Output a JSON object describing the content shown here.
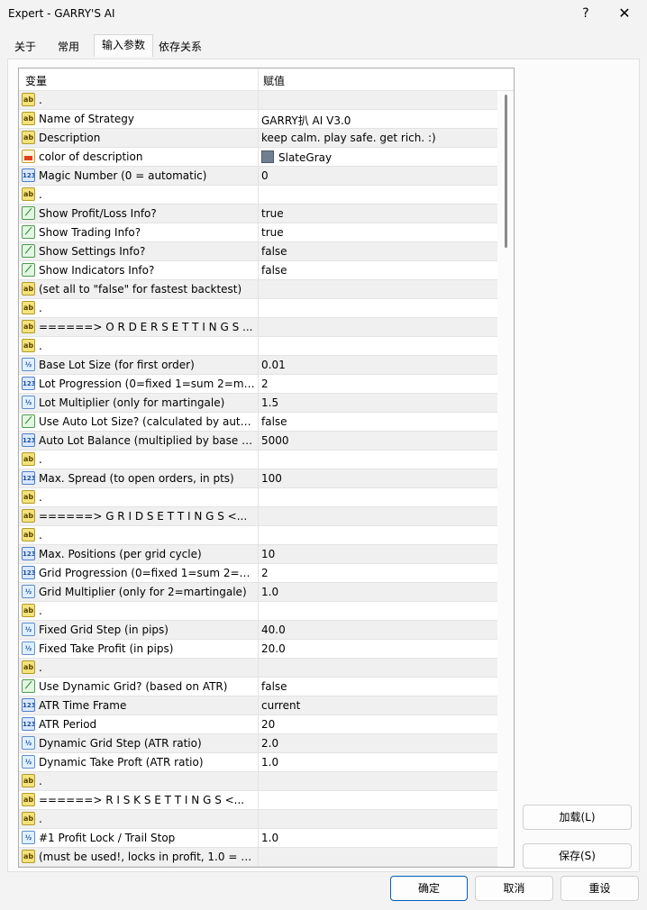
{
  "window": {
    "title": "Expert - GARRY'S AI",
    "help": "?",
    "close": "✕"
  },
  "tabs": [
    "关于",
    "常用",
    "输入参数",
    "依存关系"
  ],
  "columns": {
    "variable": "变量",
    "value": "赋值"
  },
  "rows": [
    {
      "type": "ab",
      "name": ".",
      "value": ""
    },
    {
      "type": "ab",
      "name": "Name of Strategy",
      "value": "GARRY扒 AI V3.0"
    },
    {
      "type": "ab",
      "name": "Description",
      "value": "keep calm. play safe. get rich. :)"
    },
    {
      "type": "clr",
      "name": "color of description",
      "value": "SlateGray",
      "color": "#708090"
    },
    {
      "type": "n123",
      "name": "Magic Number (0 = automatic)",
      "value": "0"
    },
    {
      "type": "ab",
      "name": ".",
      "value": ""
    },
    {
      "type": "bool",
      "name": "Show Profit/Loss Info?",
      "value": "true"
    },
    {
      "type": "bool",
      "name": "Show Trading Info?",
      "value": "true"
    },
    {
      "type": "bool",
      "name": "Show Settings Info?",
      "value": "false"
    },
    {
      "type": "bool",
      "name": "Show Indicators Info?",
      "value": "false"
    },
    {
      "type": "ab",
      "name": "(set all to \"false\" for fastest backtest)",
      "value": ""
    },
    {
      "type": "ab",
      "name": ".",
      "value": ""
    },
    {
      "type": "ab",
      "name": "======>  O R D E R   S E T T I N G S ...",
      "value": ""
    },
    {
      "type": "ab",
      "name": ".",
      "value": ""
    },
    {
      "type": "ve",
      "name": "Base Lot Size (for first order)",
      "value": "0.01"
    },
    {
      "type": "n123",
      "name": "Lot Progression (0=fixed 1=sum 2=mar...",
      "value": "2"
    },
    {
      "type": "ve",
      "name": "Lot Multiplier (only for martingale)",
      "value": "1.5"
    },
    {
      "type": "bool",
      "name": "Use Auto Lot Size? (calculated by auto l...",
      "value": "false"
    },
    {
      "type": "n123",
      "name": "Auto Lot Balance (multiplied by base lo...",
      "value": "5000"
    },
    {
      "type": "ab",
      "name": ".",
      "value": ""
    },
    {
      "type": "n123",
      "name": "Max. Spread (to open orders, in pts)",
      "value": "100"
    },
    {
      "type": "ab",
      "name": ".",
      "value": ""
    },
    {
      "type": "ab",
      "name": "======>  G R I D   S E T T I N G S  <...",
      "value": ""
    },
    {
      "type": "ab",
      "name": ".",
      "value": ""
    },
    {
      "type": "n123",
      "name": "Max. Positions (per grid cycle)",
      "value": "10"
    },
    {
      "type": "n123",
      "name": "Grid Progression (0=fixed 1=sum 2=m...",
      "value": "2"
    },
    {
      "type": "ve",
      "name": "Grid Multiplier (only for 2=martingale)",
      "value": "1.0"
    },
    {
      "type": "ab",
      "name": ".",
      "value": ""
    },
    {
      "type": "ve",
      "name": "Fixed Grid Step (in pips)",
      "value": "40.0"
    },
    {
      "type": "ve",
      "name": "Fixed Take Profit (in pips)",
      "value": "20.0"
    },
    {
      "type": "ab",
      "name": ".",
      "value": ""
    },
    {
      "type": "bool",
      "name": "Use Dynamic Grid? (based on ATR)",
      "value": "false"
    },
    {
      "type": "n123",
      "name": "ATR Time Frame",
      "value": "current"
    },
    {
      "type": "n123",
      "name": "ATR Period",
      "value": "20"
    },
    {
      "type": "ve",
      "name": "Dynamic Grid Step (ATR ratio)",
      "value": "2.0"
    },
    {
      "type": "ve",
      "name": "Dynamic Take Proft (ATR ratio)",
      "value": "1.0"
    },
    {
      "type": "ab",
      "name": ".",
      "value": ""
    },
    {
      "type": "ab",
      "name": "======>  R I S K   S E T T I N G S  <...",
      "value": ""
    },
    {
      "type": "ab",
      "name": ".",
      "value": ""
    },
    {
      "type": "ve",
      "name": "#1 Profit Lock / Trail Stop",
      "value": "1.0"
    },
    {
      "type": "ab",
      "name": "(must be used!, locks in profit, 1.0 = 10...",
      "value": ""
    }
  ],
  "side_buttons": {
    "load": "加载(L)",
    "save": "保存(S)"
  },
  "footer_buttons": {
    "ok": "确定",
    "cancel": "取消",
    "reset": "重设"
  }
}
